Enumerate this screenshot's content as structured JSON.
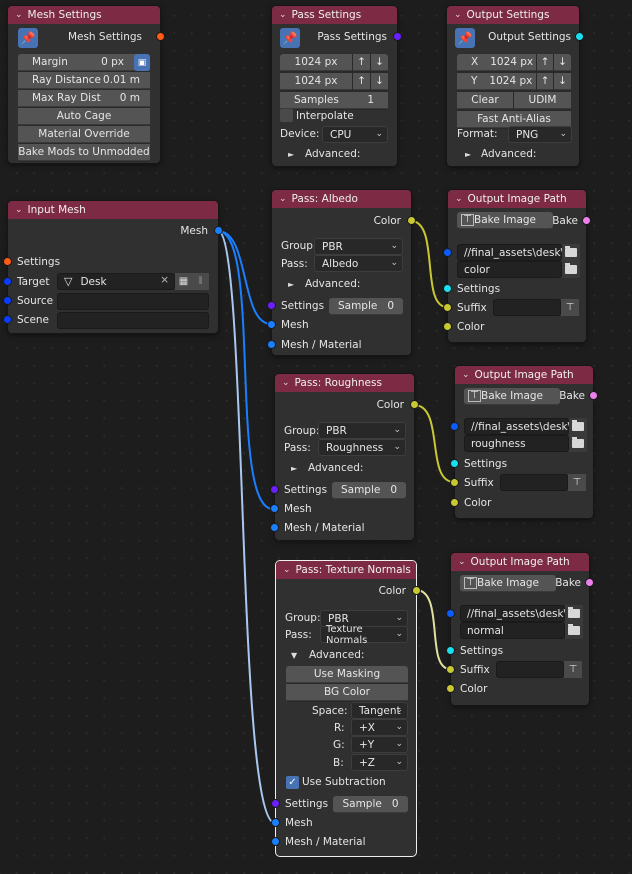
{
  "colors": {
    "header": "#7d2b44",
    "socket_mesh_settings": "#ff5a14",
    "socket_pass_settings": "#6a1fff",
    "socket_output_settings": "#19e0f0",
    "socket_mesh": "#1a7fff",
    "socket_object": "#0a3cff",
    "socket_color": "#c8c832",
    "socket_bake": "#ee80ee",
    "wire_mesh": "#1a7fff",
    "wire_mesh_selected": "#a8c8f0",
    "wire_color": "#c8c832",
    "wire_color_selected": "#e0e0a0"
  },
  "mesh_settings": {
    "title": "Mesh Settings",
    "pin_icon": "pin-icon",
    "output_label": "Mesh Settings",
    "margin_label": "Margin",
    "margin_value": "0 px",
    "margin_icon": "image-extend-icon",
    "ray_distance_label": "Ray Distance",
    "ray_distance_value": "0.01 m",
    "max_ray_label": "Max Ray Dist",
    "max_ray_value": "0 m",
    "auto_cage": "Auto Cage",
    "material_override": "Material Override",
    "bake_mods": "Bake Mods to Unmodded"
  },
  "pass_settings": {
    "title": "Pass Settings",
    "pin_icon": "pin-icon",
    "output_label": "Pass Settings",
    "width_value": "1024 px",
    "height_value": "1024 px",
    "up_icon": "↑",
    "down_icon": "↓",
    "samples_label": "Samples",
    "samples_value": "1",
    "interpolate_label": "Interpolate",
    "interpolate_checked": false,
    "device_label": "Device:",
    "device_value": "CPU",
    "advanced_label": "Advanced:"
  },
  "output_settings": {
    "title": "Output Settings",
    "pin_icon": "pin-icon",
    "output_label": "Output Settings",
    "x_label": "X",
    "x_value": "1024 px",
    "y_label": "Y",
    "y_value": "1024 px",
    "clear_label": "Clear",
    "udim_label": "UDIM",
    "fast_aa_label": "Fast Anti-Alias",
    "format_label": "Format:",
    "format_value": "PNG",
    "advanced_label": "Advanced:"
  },
  "input_mesh": {
    "title": "Input Mesh",
    "output_label": "Mesh",
    "settings_label": "Settings",
    "target_label": "Target",
    "target_value": "Desk",
    "target_clear": "×",
    "source_label": "Source",
    "source_value": "",
    "scene_label": "Scene",
    "scene_value": ""
  },
  "passes": [
    {
      "title": "Pass: Albedo",
      "color_label": "Color",
      "group_label": "Group:",
      "group_value": "PBR",
      "pass_label": "Pass:",
      "pass_value": "Albedo",
      "advanced_label": "Advanced:",
      "settings_label": "Settings",
      "sample_label": "Sample",
      "sample_value": "0",
      "mesh_label": "Mesh",
      "mesh_material_label": "Mesh / Material"
    },
    {
      "title": "Pass: Roughness",
      "color_label": "Color",
      "group_label": "Group:",
      "group_value": "PBR",
      "pass_label": "Pass:",
      "pass_value": "Roughness",
      "advanced_label": "Advanced:",
      "settings_label": "Settings",
      "sample_label": "Sample",
      "sample_value": "0",
      "mesh_label": "Mesh",
      "mesh_material_label": "Mesh / Material"
    },
    {
      "title": "Pass: Texture Normals",
      "color_label": "Color",
      "group_label": "Group:",
      "group_value": "PBR",
      "pass_label": "Pass:",
      "pass_value": "Texture Normals",
      "advanced_label": "Advanced:",
      "use_masking": "Use Masking",
      "bg_color": "BG Color",
      "space_label": "Space:",
      "space_value": "Tangent",
      "r_label": "R:",
      "r_value": "+X",
      "g_label": "G:",
      "g_value": "+Y",
      "b_label": "B:",
      "b_value": "+Z",
      "use_subtraction_label": "Use Subtraction",
      "use_subtraction_checked": true,
      "settings_label": "Settings",
      "sample_label": "Sample",
      "sample_value": "0",
      "mesh_label": "Mesh",
      "mesh_material_label": "Mesh / Material"
    }
  ],
  "outputs": [
    {
      "title": "Output Image Path",
      "bake_image_label": "Bake Image",
      "bake_label": "Bake",
      "path_value": "//final_assets\\desk\\",
      "name_value": "color",
      "settings_label": "Settings",
      "suffix_label": "Suffix",
      "suffix_value": "",
      "color_label": "Color"
    },
    {
      "title": "Output Image Path",
      "bake_image_label": "Bake Image",
      "bake_label": "Bake",
      "path_value": "//final_assets\\desk\\",
      "name_value": "roughness",
      "settings_label": "Settings",
      "suffix_label": "Suffix",
      "suffix_value": "",
      "color_label": "Color"
    },
    {
      "title": "Output Image Path",
      "bake_image_label": "Bake Image",
      "bake_label": "Bake",
      "path_value": "//final_assets\\desk\\",
      "name_value": "normal",
      "settings_label": "Settings",
      "suffix_label": "Suffix",
      "suffix_value": "",
      "color_label": "Color"
    }
  ]
}
